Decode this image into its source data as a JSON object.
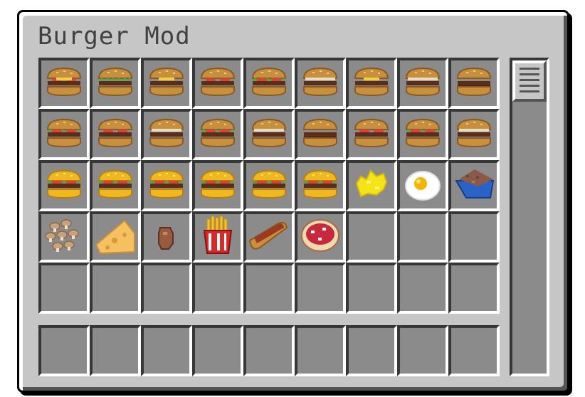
{
  "window": {
    "title": "Burger Mod"
  },
  "inventory": {
    "rows": [
      [
        "burger-tomato-cheese",
        "burger-lettuce",
        "burger-cheese",
        "burger-tomato",
        "burger-lettuce-tomato",
        "burger-plain",
        "burger-cheese",
        "burger-plain",
        "burger-double"
      ],
      [
        "burger-lettuce-tomato",
        "burger-tomato",
        "burger-plain",
        "burger-lettuce-tomato",
        "burger-plain",
        "burger-double",
        "burger-tomato",
        "burger-lettuce-tomato",
        "burger-plain"
      ],
      [
        "golden-burger",
        "golden-burger",
        "golden-burger",
        "golden-burger",
        "golden-burger",
        "golden-burger",
        "scrambled-egg-icon",
        "fried-egg-icon",
        "ground-beef-tray-icon"
      ],
      [
        "mushrooms-icon",
        "cheese-wedge-icon",
        "raw-meat-icon",
        "fries-icon",
        "hotdog-icon",
        "pizza-icon",
        "",
        "",
        ""
      ],
      [
        "",
        "",
        "",
        "",
        "",
        "",
        "",
        "",
        ""
      ]
    ],
    "hotbar": [
      "",
      "",
      "",
      "",
      "",
      "",
      "",
      "",
      ""
    ]
  },
  "scrollbar": {
    "position": 0
  },
  "colors": {
    "panel": "#c6c6c6",
    "slot": "#8b8b8b",
    "title": "#404040"
  }
}
